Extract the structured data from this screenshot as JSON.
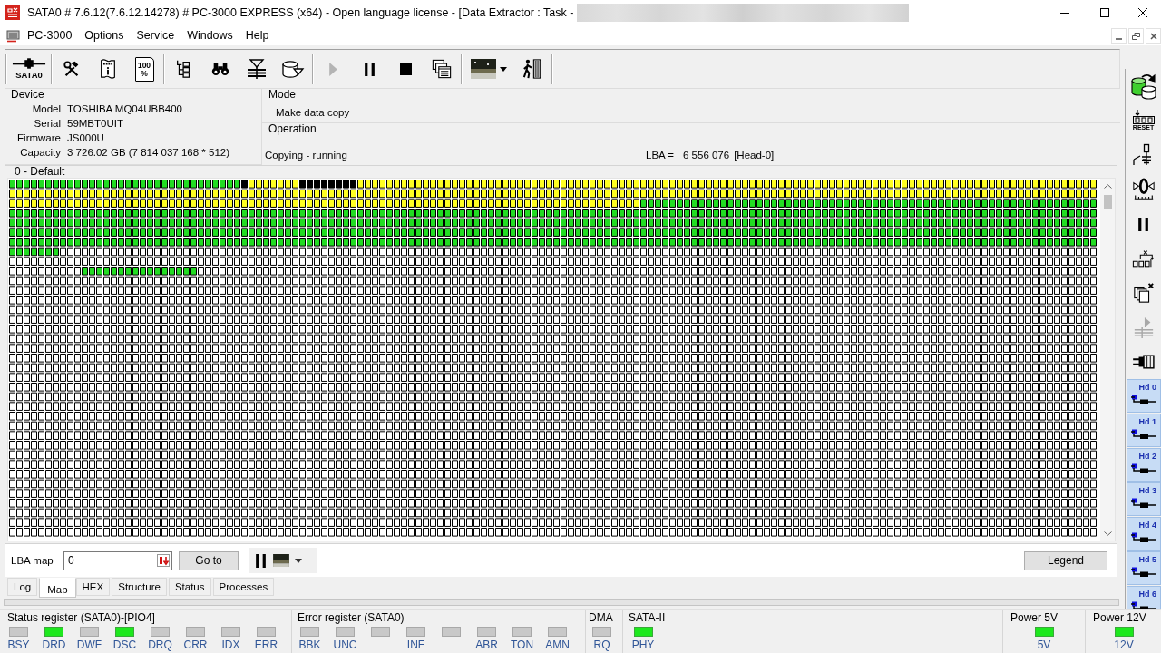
{
  "window": {
    "title": "SATA0 # 7.6.12(7.6.12.14278) # PC-3000 EXPRESS (x64) - Open language license - [Data Extractor : Task -",
    "redacted": true
  },
  "menu": [
    "PC-3000",
    "Options",
    "Service",
    "Windows",
    "Help"
  ],
  "toolbar": [
    {
      "buttons": [
        {
          "kind": "port",
          "label": "SATA0",
          "disabled": false
        }
      ]
    },
    {
      "buttons": [
        {
          "kind": "tools",
          "disabled": false
        },
        {
          "kind": "info",
          "disabled": false
        },
        {
          "kind": "percent",
          "label": "100 %",
          "disabled": false
        }
      ]
    },
    {
      "buttons": [
        {
          "kind": "tree",
          "disabled": false
        },
        {
          "kind": "binoculars",
          "disabled": false
        },
        {
          "kind": "layers",
          "disabled": false
        },
        {
          "kind": "disk",
          "disabled": false
        }
      ]
    },
    {
      "buttons": [
        {
          "kind": "play",
          "disabled": true
        },
        {
          "kind": "pause",
          "disabled": false
        },
        {
          "kind": "stop",
          "disabled": false
        },
        {
          "kind": "windows",
          "disabled": false
        }
      ]
    },
    {
      "buttons": [
        {
          "kind": "thumbnail",
          "disabled": false
        },
        {
          "kind": "walker",
          "disabled": false
        }
      ]
    }
  ],
  "device": {
    "title": "Device",
    "fields": [
      {
        "label": "Model",
        "value": "TOSHIBA MQ04UBB400"
      },
      {
        "label": "Serial",
        "value": "59MBT0UIT"
      },
      {
        "label": "Firmware",
        "value": "JS000U"
      },
      {
        "label": "Capacity",
        "value": "3 726.02 GB (7 814 037 168 * 512)"
      }
    ]
  },
  "mode": {
    "title": "Mode",
    "value": "Make data copy"
  },
  "operation": {
    "title": "Operation",
    "value": "Copying - running",
    "lba_label": "LBA =",
    "lba_value": "6 556 076",
    "head": "[Head-0]"
  },
  "map": {
    "title": "0 - Default"
  },
  "lba_map": {
    "label": "LBA map",
    "value": "0",
    "goto": "Go to",
    "legend": "Legend"
  },
  "tabs": [
    {
      "label": "Log",
      "selected": false
    },
    {
      "label": "Map",
      "selected": true
    },
    {
      "label": "HEX",
      "selected": false
    },
    {
      "label": "Structure",
      "selected": false
    },
    {
      "label": "Status",
      "selected": false
    },
    {
      "label": "Processes",
      "selected": false
    }
  ],
  "registers": [
    {
      "title": "Status register (SATA0)-[PIO4]",
      "leds": [
        {
          "label": "BSY",
          "on": false
        },
        {
          "label": "DRD",
          "on": true
        },
        {
          "label": "DWF",
          "on": false
        },
        {
          "label": "DSC",
          "on": true
        },
        {
          "label": "DRQ",
          "on": false
        },
        {
          "label": "CRR",
          "on": false
        },
        {
          "label": "IDX",
          "on": false
        },
        {
          "label": "ERR",
          "on": false
        }
      ]
    },
    {
      "title": "Error register (SATA0)",
      "leds": [
        {
          "label": "BBK",
          "on": false
        },
        {
          "label": "UNC",
          "on": false
        },
        {
          "on": false
        },
        {
          "label": "INF",
          "on": false
        },
        {
          "on": false
        },
        {
          "label": "ABR",
          "on": false
        },
        {
          "label": "TON",
          "on": false
        },
        {
          "label": "AMN",
          "on": false
        }
      ]
    },
    {
      "title": "DMA",
      "leds": [
        {
          "label": "RQ",
          "on": false
        }
      ]
    },
    {
      "title": "SATA-II",
      "leds": [
        {
          "label": "PHY",
          "on": true
        }
      ]
    }
  ],
  "power": [
    {
      "title": "Power 5V",
      "leds": [
        {
          "label": "5V",
          "on": true
        }
      ]
    },
    {
      "title": "Power 12V",
      "leds": [
        {
          "label": "12V",
          "on": true
        }
      ]
    }
  ],
  "sidebar": {
    "tools": [
      {
        "kind": "db-copy",
        "disabled": false
      },
      {
        "kind": "reset",
        "label": "RESET",
        "disabled": false
      },
      {
        "kind": "switch",
        "disabled": false
      },
      {
        "kind": "zero",
        "disabled": false
      },
      {
        "kind": "pause",
        "disabled": false
      },
      {
        "kind": "relay",
        "disabled": false
      },
      {
        "kind": "copy-x",
        "disabled": false
      },
      {
        "kind": "play-lines",
        "disabled": true
      },
      {
        "kind": "connector",
        "disabled": false
      }
    ],
    "heads": [
      {
        "label": "Hd 0",
        "selected": true
      },
      {
        "label": "Hd 1",
        "selected": true
      },
      {
        "label": "Hd 2",
        "selected": true
      },
      {
        "label": "Hd 3",
        "selected": true
      },
      {
        "label": "Hd 4",
        "selected": true
      },
      {
        "label": "Hd 5",
        "selected": true
      },
      {
        "label": "Hd 6",
        "selected": true
      }
    ]
  }
}
